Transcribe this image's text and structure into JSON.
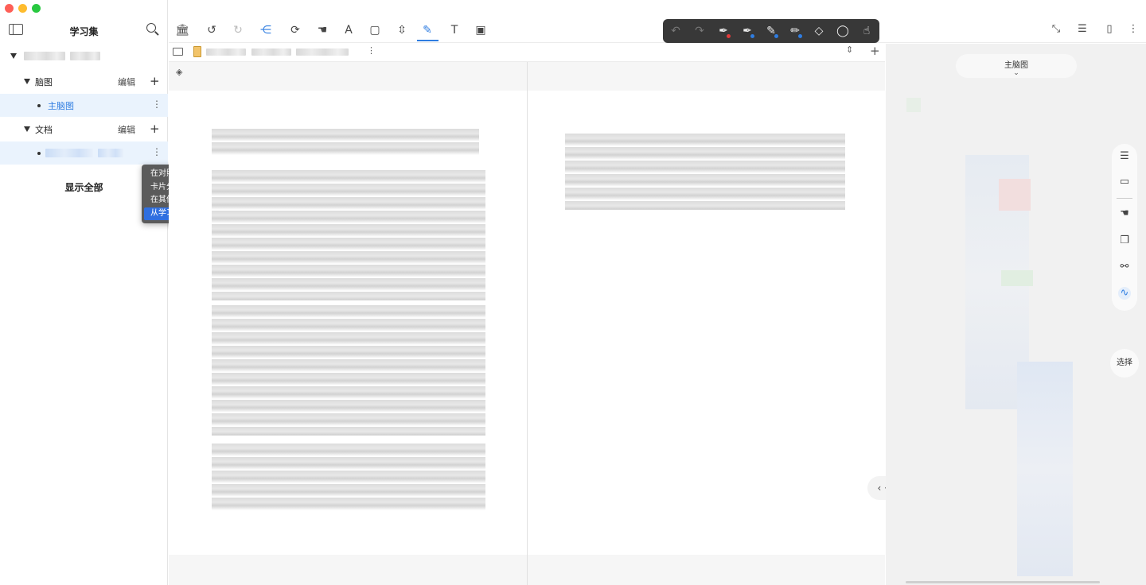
{
  "sidebar": {
    "title": "学习集",
    "groups": [
      {
        "label": "脑图",
        "edit": "编辑",
        "plus": "+",
        "items": [
          {
            "label": "主脑图"
          }
        ]
      },
      {
        "label": "文档",
        "edit": "编辑",
        "plus": "+"
      }
    ],
    "show_all": "显示全部",
    "more": "⋮"
  },
  "context_menu": {
    "items": [
      "在对照视图中打开",
      "卡片分组看板",
      "在其他学习集中打开",
      "从学习集中移除"
    ],
    "highlighted_index": 3
  },
  "toolbar": {
    "icons": [
      "library-icon",
      "undo-icon",
      "redo-icon",
      "mindmap-icon",
      "sync-icon",
      "hand-icon",
      "text-color-icon",
      "crop-icon",
      "split-icon",
      "pen-icon",
      "textbox-icon",
      "image-icon"
    ],
    "active": "pen-icon"
  },
  "pen_palette": {
    "tools": [
      "undo-icon",
      "redo-icon",
      "pen-red-icon",
      "pen-blue-icon",
      "highlighter-blue-icon",
      "pencil-blue-icon",
      "eraser-icon",
      "lasso-icon",
      "touch-icon"
    ]
  },
  "mindmap": {
    "title": "主脑图",
    "select_label": "选择",
    "nav_label": "‹ · ›"
  },
  "colors": {
    "accent": "#2f7de1",
    "palette_bg": "#383838",
    "menu_highlight": "#2f6fe0"
  }
}
